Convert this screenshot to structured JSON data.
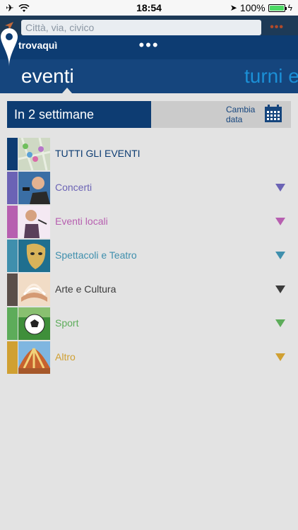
{
  "status": {
    "time": "18:54",
    "battery": "100%"
  },
  "search": {
    "placeholder": "Città, via, civico"
  },
  "header": {
    "brand": "trovaquì",
    "tabs": [
      {
        "label": "eventi"
      },
      {
        "label": "turni e"
      }
    ]
  },
  "date_bar": {
    "label": "In 2 settimane",
    "change_date": "Cambia data"
  },
  "categories": [
    {
      "label": "TUTTI GLI EVENTI",
      "color": "#0d3c72",
      "text_color": "#0d3c72",
      "has_arrow": false
    },
    {
      "label": "Concerti",
      "color": "#6b63b5",
      "text_color": "#6b63b5",
      "has_arrow": true
    },
    {
      "label": "Eventi locali",
      "color": "#b75fb0",
      "text_color": "#b75fb0",
      "has_arrow": true
    },
    {
      "label": "Spettacoli e Teatro",
      "color": "#3f8fad",
      "text_color": "#3f8fad",
      "has_arrow": true
    },
    {
      "label": "Arte e Cultura",
      "color": "#5a4f4a",
      "text_color": "#3b3b3b",
      "has_arrow": true
    },
    {
      "label": "Sport",
      "color": "#5dac5a",
      "text_color": "#5dac5a",
      "has_arrow": true
    },
    {
      "label": "Altro",
      "color": "#d0a032",
      "text_color": "#d0a032",
      "has_arrow": true
    }
  ]
}
